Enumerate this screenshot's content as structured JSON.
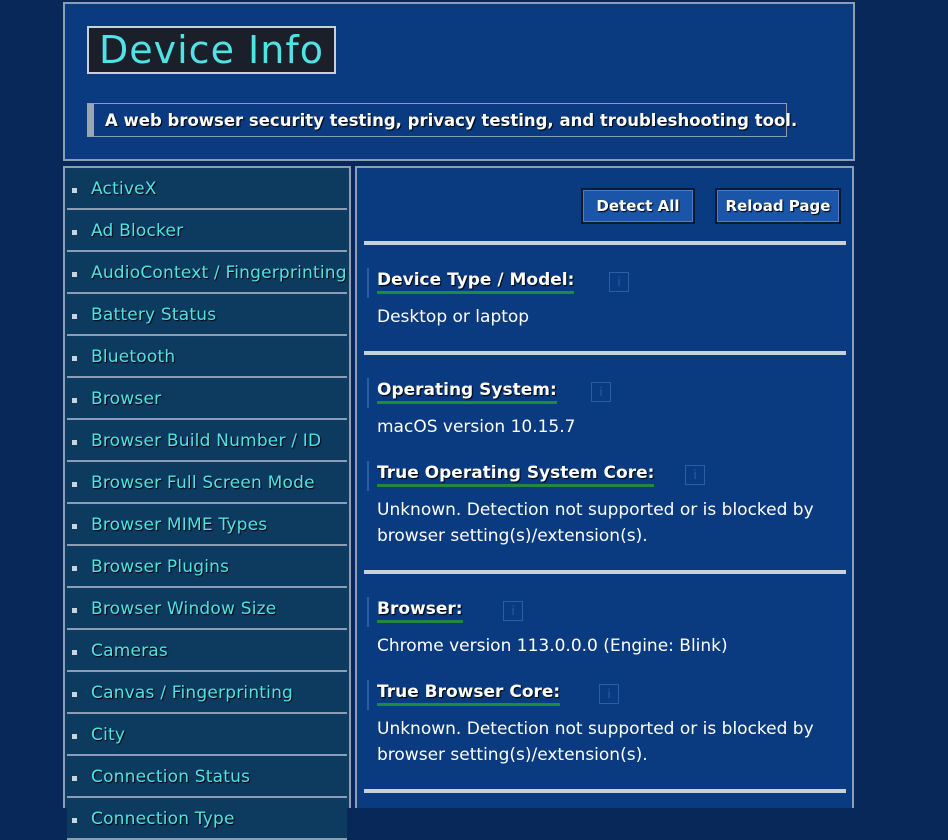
{
  "header": {
    "title": "Device Info",
    "tagline": "A web browser security testing, privacy testing, and troubleshooting tool."
  },
  "sidebar": {
    "items": [
      {
        "label": "ActiveX"
      },
      {
        "label": "Ad Blocker"
      },
      {
        "label": "AudioContext / Fingerprinting"
      },
      {
        "label": "Battery Status"
      },
      {
        "label": "Bluetooth"
      },
      {
        "label": "Browser"
      },
      {
        "label": "Browser Build Number / ID"
      },
      {
        "label": "Browser Full Screen Mode"
      },
      {
        "label": "Browser MIME Types"
      },
      {
        "label": "Browser Plugins"
      },
      {
        "label": "Browser Window Size"
      },
      {
        "label": "Cameras"
      },
      {
        "label": "Canvas / Fingerprinting"
      },
      {
        "label": "City"
      },
      {
        "label": "Connection Status"
      },
      {
        "label": "Connection Type"
      }
    ]
  },
  "toolbar": {
    "detect_all_label": "Detect All",
    "reload_page_label": "Reload Page"
  },
  "main": {
    "info_glyph": "i",
    "fields": [
      {
        "title": "Device Type / Model:",
        "value": "Desktop or laptop"
      },
      {
        "title": "Operating System:",
        "value": "macOS version 10.15.7"
      },
      {
        "title": "True Operating System Core:",
        "value": "Unknown. Detection not supported or is blocked by browser setting(s)/extension(s)."
      },
      {
        "title": "Browser:",
        "value": "Chrome version 113.0.0.0 (Engine: Blink)"
      },
      {
        "title": "True Browser Core:",
        "value": "Unknown. Detection not supported or is blocked by browser setting(s)/extension(s)."
      }
    ]
  }
}
